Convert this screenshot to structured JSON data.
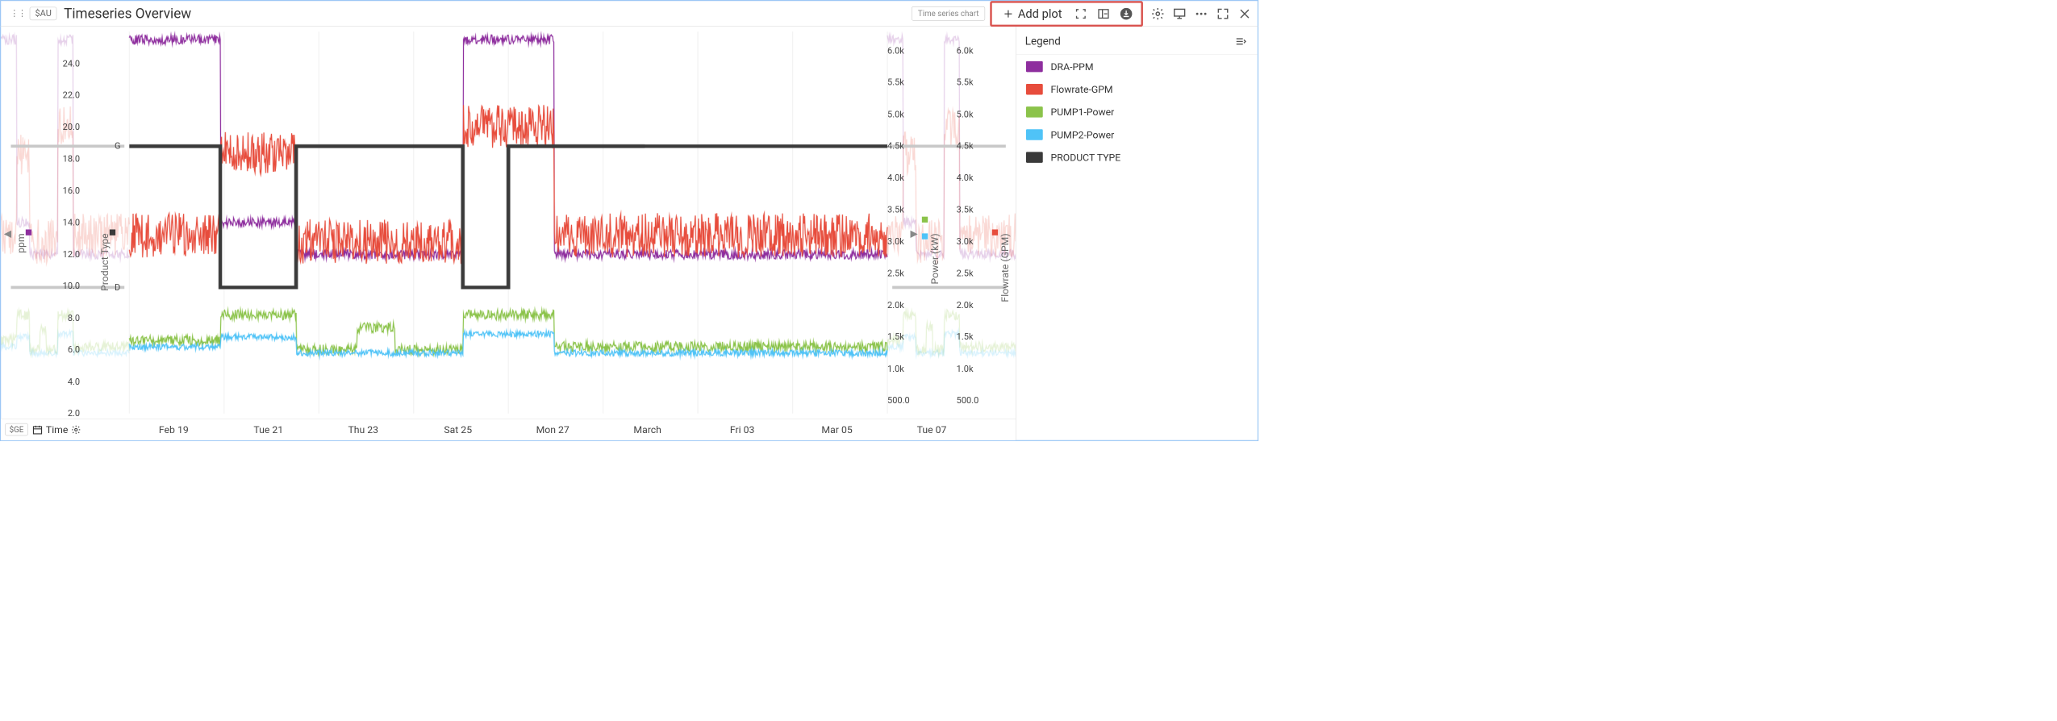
{
  "header": {
    "au_chip": "$AU",
    "title": "Timeseries Overview",
    "chart_type_label": "Time series chart",
    "add_plot_label": "Add plot"
  },
  "bottombar": {
    "ge_chip": "$GE",
    "time_label": "Time"
  },
  "legend": {
    "title": "Legend",
    "items": [
      {
        "label": "DRA-PPM",
        "color": "#8e2e9e"
      },
      {
        "label": "Flowrate-GPM",
        "color": "#e74c3c"
      },
      {
        "label": "PUMP1-Power",
        "color": "#8bc34a"
      },
      {
        "label": "PUMP2-Power",
        "color": "#4fc3f7"
      },
      {
        "label": "PRODUCT TYPE",
        "color": "#3a3a3a"
      }
    ]
  },
  "axes": {
    "left1": {
      "label": "ppm",
      "marker_color": "#8e2e9e"
    },
    "left2": {
      "label": "Product Type",
      "marker_color": "#3a3a3a"
    },
    "right1": {
      "label": "Power (kW)",
      "marker1": "#8bc34a",
      "marker2": "#4fc3f7"
    },
    "right2": {
      "label": "Flowrate (GPM)",
      "marker_color": "#e74c3c"
    },
    "productTicks": {
      "G": "G",
      "D": "D"
    }
  },
  "chart_data": {
    "type": "line",
    "xlabel": "",
    "x_categories": [
      "Feb 19",
      "Tue 21",
      "Thu 23",
      "Sat 25",
      "Mon 27",
      "March",
      "Fri 03",
      "Mar 05",
      "Tue 07"
    ],
    "axes": {
      "ppm": {
        "label": "ppm",
        "ticks": [
          2.0,
          4.0,
          6.0,
          8.0,
          10.0,
          12.0,
          14.0,
          16.0,
          18.0,
          20.0,
          22.0,
          24.0
        ],
        "range": [
          2.0,
          26.0
        ]
      },
      "power_kw": {
        "label": "Power (kW)",
        "ticks": [
          500.0,
          1000,
          1500,
          2000,
          2500,
          3000,
          3500,
          4000,
          4500,
          5000,
          5500,
          6000
        ],
        "tick_labels": [
          "500.0",
          "1.0k",
          "1.5k",
          "2.0k",
          "2.5k",
          "3.0k",
          "3.5k",
          "4.0k",
          "4.5k",
          "5.0k",
          "5.5k",
          "6.0k"
        ],
        "range": [
          300,
          6300
        ]
      },
      "gpm": {
        "label": "Flowrate (GPM)",
        "ticks": [
          500.0,
          1000,
          1500,
          2000,
          2500,
          3000,
          3500,
          4000,
          4500,
          5000,
          5500,
          6000
        ],
        "tick_labels": [
          "500.0",
          "1.0k",
          "1.5k",
          "2.0k",
          "2.5k",
          "3.0k",
          "3.5k",
          "4.0k",
          "4.5k",
          "5.0k",
          "5.5k",
          "6.0k"
        ],
        "range": [
          300,
          6300
        ]
      },
      "product": {
        "label": "Product Type",
        "categorical": [
          "G",
          "D"
        ]
      }
    },
    "series": [
      {
        "name": "DRA-PPM",
        "axis": "ppm",
        "color": "#8e2e9e",
        "noise": 0.3,
        "segments": [
          {
            "x0": 0.0,
            "x1": 0.12,
            "y": 25.5
          },
          {
            "x0": 0.12,
            "x1": 0.22,
            "y": 14.0
          },
          {
            "x0": 0.22,
            "x1": 0.44,
            "y": 12.0
          },
          {
            "x0": 0.44,
            "x1": 0.56,
            "y": 25.5
          },
          {
            "x0": 0.56,
            "x1": 1.0,
            "y": 12.0
          }
        ]
      },
      {
        "name": "Flowrate-GPM",
        "axis": "gpm",
        "color": "#e74c3c",
        "noise": 350,
        "segments": [
          {
            "x0": 0.0,
            "x1": 0.12,
            "y": 3100
          },
          {
            "x0": 0.12,
            "x1": 0.22,
            "y": 4400
          },
          {
            "x0": 0.22,
            "x1": 0.44,
            "y": 3000
          },
          {
            "x0": 0.44,
            "x1": 0.56,
            "y": 4800
          },
          {
            "x0": 0.56,
            "x1": 1.0,
            "y": 3100
          }
        ]
      },
      {
        "name": "PUMP1-Power",
        "axis": "power_kw",
        "color": "#8bc34a",
        "noise": 80,
        "segments": [
          {
            "x0": 0.0,
            "x1": 0.12,
            "y": 1450
          },
          {
            "x0": 0.12,
            "x1": 0.22,
            "y": 1850
          },
          {
            "x0": 0.22,
            "x1": 0.3,
            "y": 1300
          },
          {
            "x0": 0.3,
            "x1": 0.35,
            "y": 1650
          },
          {
            "x0": 0.35,
            "x1": 0.44,
            "y": 1300
          },
          {
            "x0": 0.44,
            "x1": 0.56,
            "y": 1850
          },
          {
            "x0": 0.56,
            "x1": 1.0,
            "y": 1350
          }
        ]
      },
      {
        "name": "PUMP2-Power",
        "axis": "power_kw",
        "color": "#4fc3f7",
        "noise": 50,
        "segments": [
          {
            "x0": 0.0,
            "x1": 0.12,
            "y": 1350
          },
          {
            "x0": 0.12,
            "x1": 0.22,
            "y": 1500
          },
          {
            "x0": 0.22,
            "x1": 0.44,
            "y": 1250
          },
          {
            "x0": 0.44,
            "x1": 0.56,
            "y": 1550
          },
          {
            "x0": 0.56,
            "x1": 1.0,
            "y": 1250
          }
        ]
      },
      {
        "name": "PRODUCT TYPE",
        "axis": "product",
        "color": "#3a3a3a",
        "step": true,
        "points": [
          {
            "x": 0.0,
            "y": "G"
          },
          {
            "x": 0.12,
            "y": "D"
          },
          {
            "x": 0.22,
            "y": "G"
          },
          {
            "x": 0.44,
            "y": "D"
          },
          {
            "x": 0.5,
            "y": "G"
          },
          {
            "x": 0.66,
            "y": "G"
          }
        ]
      }
    ]
  }
}
